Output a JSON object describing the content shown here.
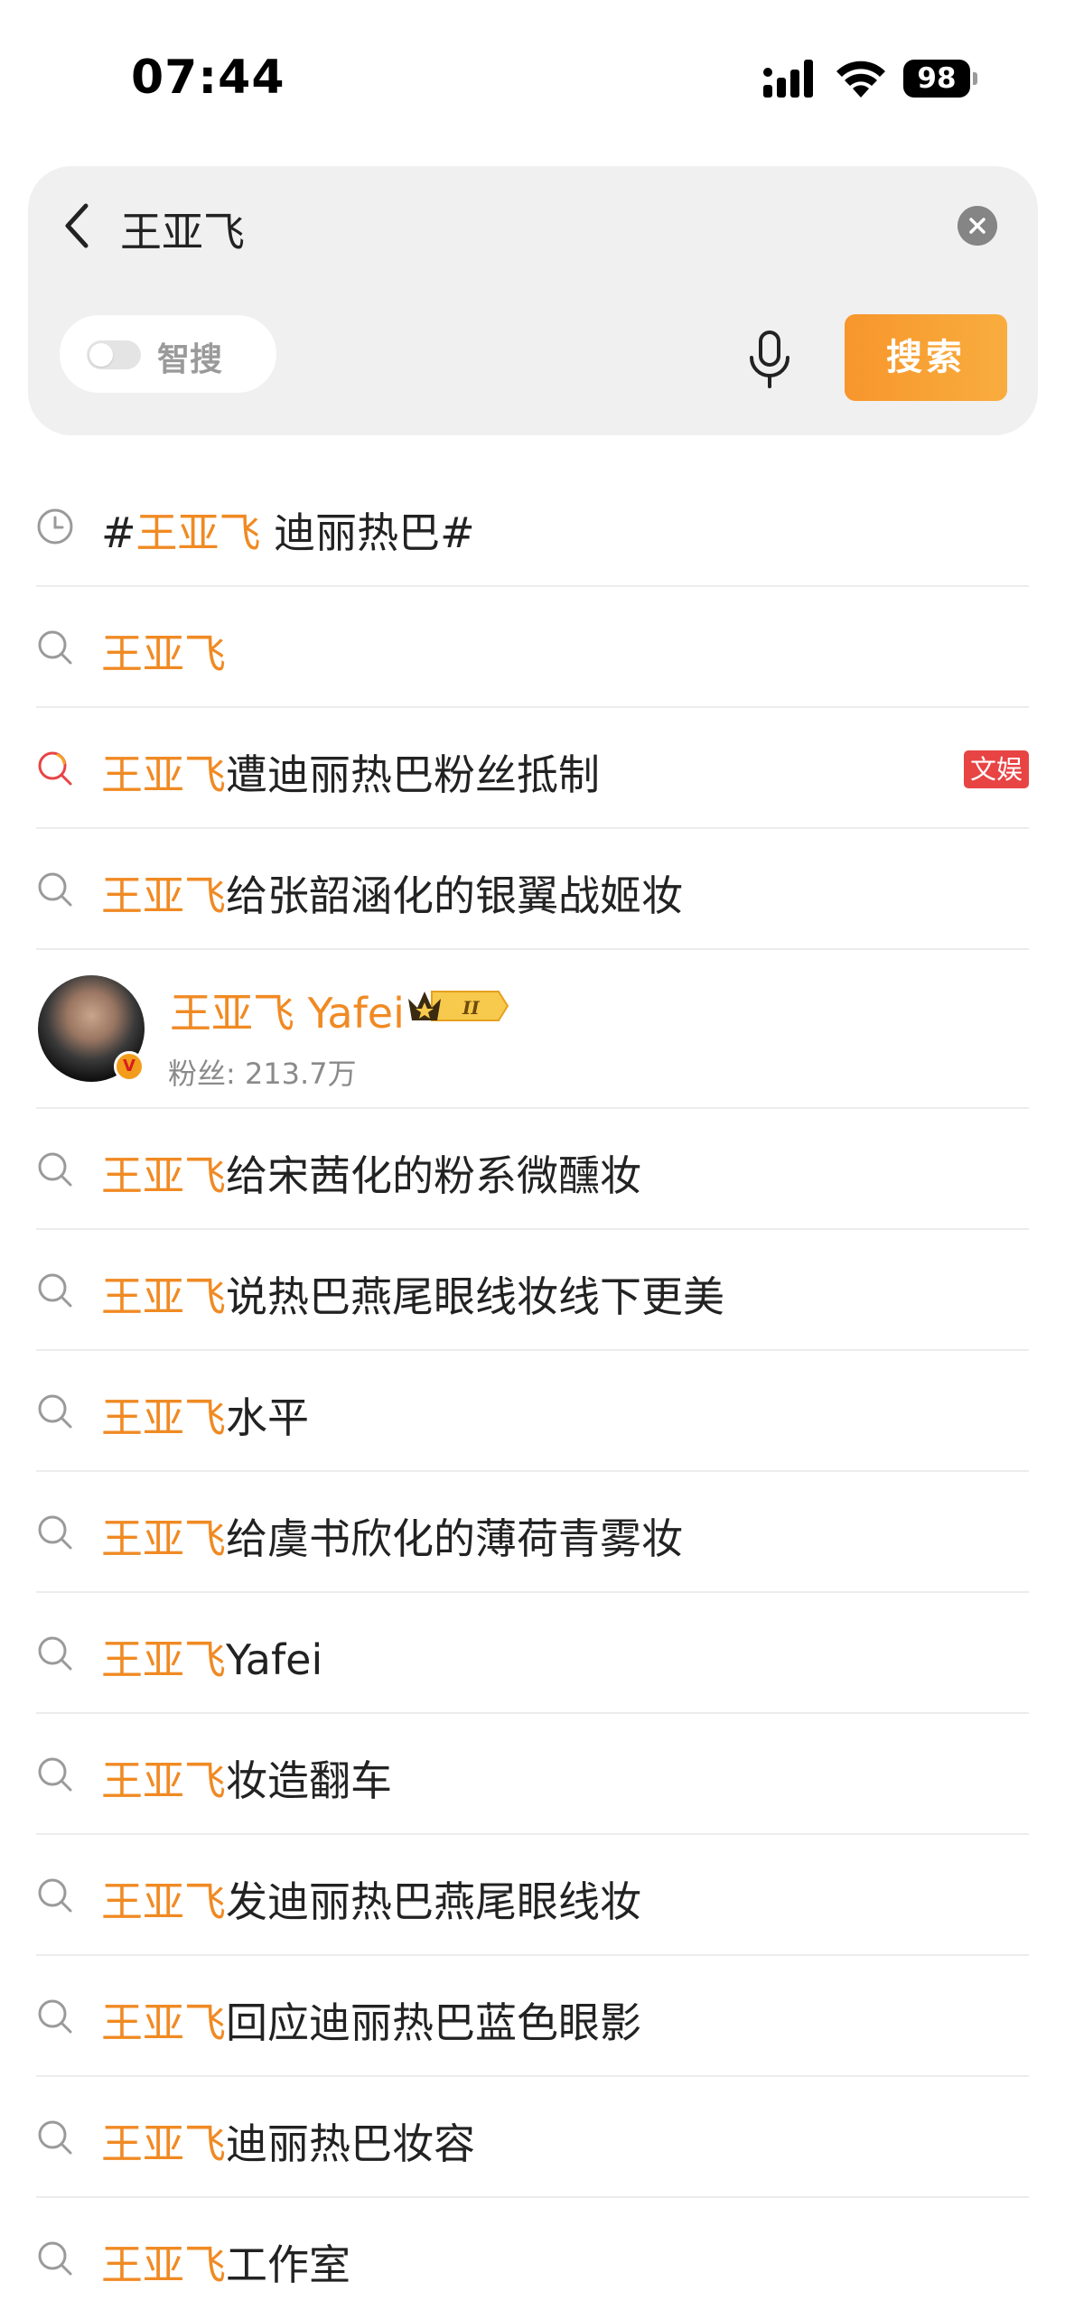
{
  "status_bar": {
    "time": "07:44",
    "battery": "98"
  },
  "search": {
    "query": "王亚飞",
    "smart_label": "智搜",
    "smart_enabled": false,
    "button_label": "搜索",
    "accent_color": "#f7962c"
  },
  "suggestions": [
    {
      "icon": "history-clock-icon",
      "prefix": "#",
      "highlight": "王亚飞",
      "rest": " 迪丽热巴#"
    },
    {
      "icon": "search-icon",
      "prefix": "",
      "highlight": "王亚飞",
      "rest": ""
    },
    {
      "icon": "hot-search-icon",
      "prefix": "",
      "highlight": "王亚飞",
      "rest": "遭迪丽热巴粉丝抵制",
      "badge": "文娱"
    },
    {
      "icon": "search-icon",
      "prefix": "",
      "highlight": "王亚飞",
      "rest": "给张韶涵化的银翼战姬妆"
    }
  ],
  "user_card": {
    "name": "王亚飞 Yafei",
    "fans": "粉丝: 213.7万",
    "verified_badge": "V",
    "crown_level": "II"
  },
  "suggestions_after": [
    {
      "icon": "search-icon",
      "highlight": "王亚飞",
      "rest": "给宋茜化的粉系微醺妆"
    },
    {
      "icon": "search-icon",
      "highlight": "王亚飞",
      "rest": "说热巴燕尾眼线妆线下更美"
    },
    {
      "icon": "search-icon",
      "highlight": "王亚飞",
      "rest": "水平"
    },
    {
      "icon": "search-icon",
      "highlight": "王亚飞",
      "rest": "给虞书欣化的薄荷青雾妆"
    },
    {
      "icon": "search-icon",
      "highlight": "王亚飞",
      "rest": "Yafei"
    },
    {
      "icon": "search-icon",
      "highlight": "王亚飞",
      "rest": "妆造翻车"
    },
    {
      "icon": "search-icon",
      "highlight": "王亚飞",
      "rest": "发迪丽热巴燕尾眼线妆"
    },
    {
      "icon": "search-icon",
      "highlight": "王亚飞",
      "rest": "回应迪丽热巴蓝色眼影"
    },
    {
      "icon": "search-icon",
      "highlight": "王亚飞",
      "rest": "迪丽热巴妆容"
    },
    {
      "icon": "search-icon",
      "highlight": "王亚飞",
      "rest": "工作室"
    }
  ]
}
